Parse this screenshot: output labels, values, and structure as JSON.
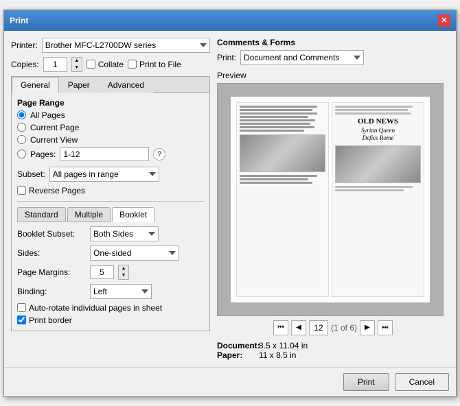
{
  "dialog": {
    "title": "Print",
    "close_label": "✕"
  },
  "printer": {
    "label": "Printer:",
    "value": "Brother MFC-L2700DW series"
  },
  "copies": {
    "label": "Copies:",
    "value": "1"
  },
  "collate": {
    "label": "Collate"
  },
  "print_to_file": {
    "label": "Print to File"
  },
  "tabs": {
    "general": "General",
    "paper": "Paper",
    "advanced": "Advanced"
  },
  "page_range": {
    "heading": "Page Range",
    "all_pages": "All Pages",
    "current_page": "Current Page",
    "current_view": "Current View",
    "pages_label": "Pages:",
    "pages_value": "1-12"
  },
  "subset": {
    "label": "Subset:",
    "value": "All pages in range"
  },
  "reverse_pages": "Reverse Pages",
  "sub_tabs": {
    "standard": "Standard",
    "multiple": "Multiple",
    "booklet": "Booklet"
  },
  "booklet": {
    "subset_label": "Booklet Subset:",
    "subset_value": "Both Sides",
    "sides_label": "Sides:",
    "sides_value": "One-sided",
    "margins_label": "Page Margins:",
    "margins_value": "5",
    "binding_label": "Binding:",
    "binding_value": "Left",
    "auto_rotate": "Auto-rotate individual pages in sheet",
    "print_border": "Print border"
  },
  "comments_forms": {
    "heading": "Comments & Forms",
    "print_label": "Print:",
    "print_value": "Document and Comments"
  },
  "preview": {
    "heading": "Preview",
    "page_current": "12",
    "page_of": "(1 of 6)",
    "headline": "OLD NEWS",
    "subhead_line1": "Syrian Queen",
    "subhead_line2": "Defies Rome"
  },
  "doc_info": {
    "document_label": "Document:",
    "document_value": "8.5 x 11.04 in",
    "paper_label": "Paper:",
    "paper_value": "11 x 8.5 in"
  },
  "buttons": {
    "print": "Print",
    "cancel": "Cancel"
  }
}
